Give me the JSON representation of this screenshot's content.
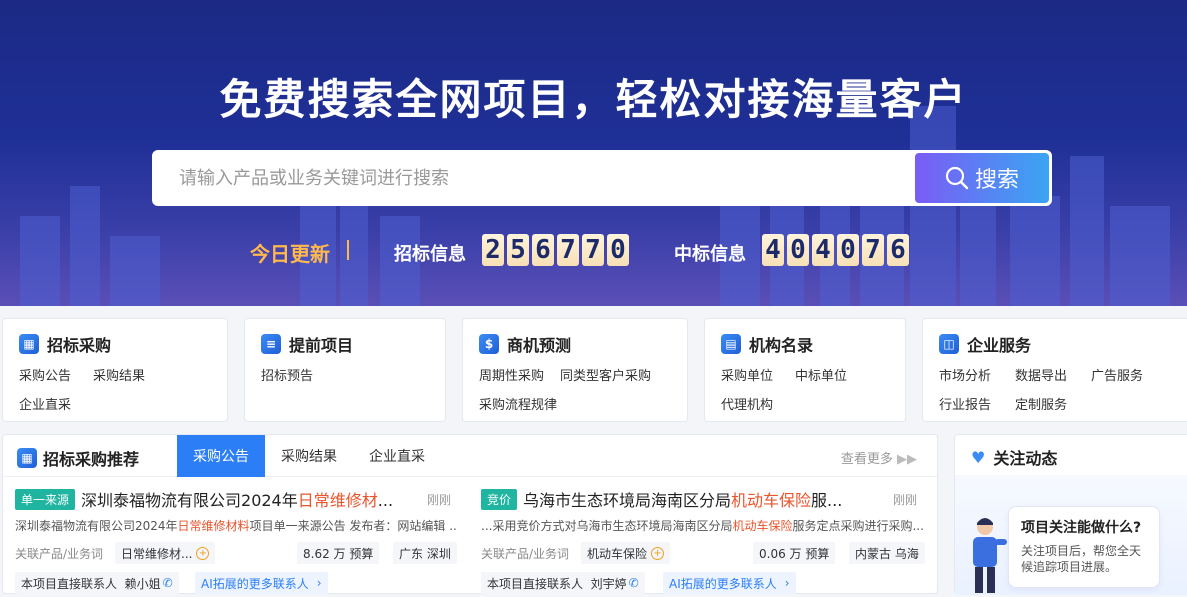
{
  "hero": {
    "title": "免费搜索全网项目，轻松对接海量客户",
    "search_placeholder": "请输入产品或业务关键词进行搜索",
    "search_button": "搜索",
    "today_label": "今日更新",
    "bid_label": "招标信息",
    "bid_digits": [
      "2",
      "5",
      "6",
      "7",
      "7",
      "0"
    ],
    "win_label": "中标信息",
    "win_digits": [
      "4",
      "0",
      "4",
      "0",
      "7",
      "6"
    ]
  },
  "categories": [
    {
      "title": "招标采购",
      "links": [
        "采购公告",
        "采购结果",
        "企业直采"
      ]
    },
    {
      "title": "提前项目",
      "links": [
        "招标预告"
      ]
    },
    {
      "title": "商机预测",
      "links": [
        "周期性采购",
        "同类型客户采购",
        "采购流程规律"
      ]
    },
    {
      "title": "机构名录",
      "links": [
        "采购单位",
        "中标单位",
        "代理机构"
      ]
    },
    {
      "title": "企业服务",
      "links": [
        "市场分析",
        "数据导出",
        "广告服务",
        "行业报告",
        "定制服务"
      ]
    }
  ],
  "recommend": {
    "title": "招标采购推荐",
    "tabs": [
      "采购公告",
      "采购结果",
      "企业直采"
    ],
    "more": "查看更多",
    "items": [
      {
        "badge": "单一来源",
        "title_pre": "深圳泰福物流有限公司2024年",
        "title_hl": "日常维修材",
        "title_post": "...",
        "time": "刚刚",
        "summary_pre": "深圳泰福物流有限公司2024年",
        "summary_hl": "日常维修材料",
        "summary_post": "项目单一来源公告 发布者：网站编辑 ...",
        "product_label": "关联产品/业务词",
        "product": "日常维修材...",
        "budget": "8.62 万 预算",
        "region": "广东 深圳",
        "contact_label": "本项目直接联系人",
        "contact_name": "赖小姐",
        "ai_contact": "AI拓展的更多联系人"
      },
      {
        "badge": "竞价",
        "title_pre": "乌海市生态环境局海南区分局",
        "title_hl": "机动车保险",
        "title_post": "服...",
        "time": "刚刚",
        "summary_pre": "...采用竞价方式对乌海市生态环境局海南区分局",
        "summary_hl": "机动车保险",
        "summary_post": "服务定点采购进行采购...",
        "product_label": "关联产品/业务词",
        "product": "机动车保险",
        "budget": "0.06 万 预算",
        "region": "内蒙古 乌海",
        "contact_label": "本项目直接联系人",
        "contact_name": "刘宇婷",
        "ai_contact": "AI拓展的更多联系人"
      }
    ]
  },
  "follow": {
    "title": "关注动态",
    "bubble_title": "项目关注能做什么?",
    "bubble_text": "关注项目后，帮您全天候追踪项目进展。"
  },
  "colors": {
    "accent": "#2b7ef5",
    "highlight": "#e8542c",
    "gold": "#ffb84d"
  }
}
